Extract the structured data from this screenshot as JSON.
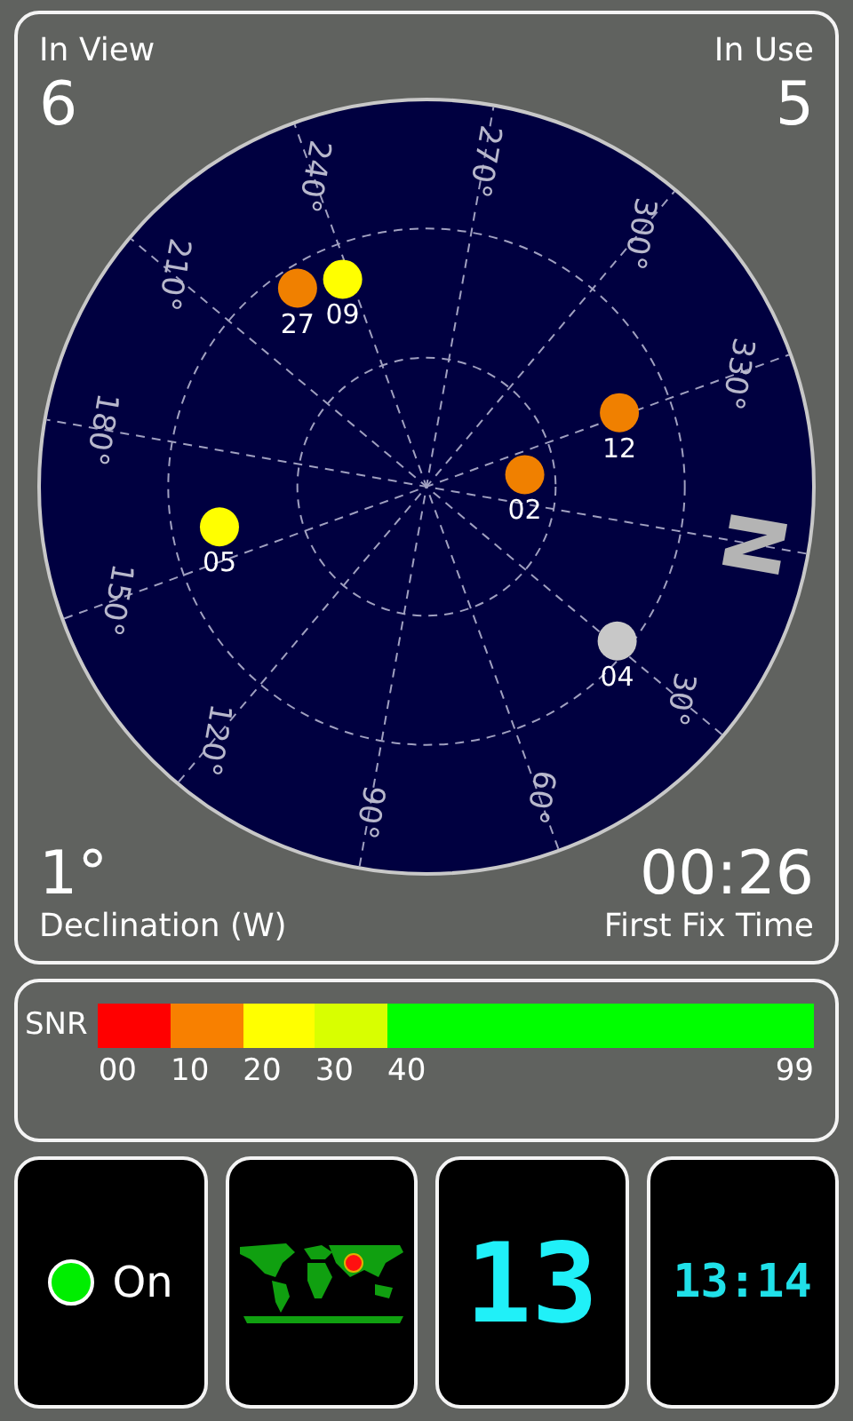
{
  "sky": {
    "in_view": {
      "label": "In View",
      "value": "6"
    },
    "in_use": {
      "label": "In Use",
      "value": "5"
    },
    "declination": {
      "label": "Declination (W)",
      "value": "1°"
    },
    "first_fix": {
      "label": "First Fix Time",
      "value": "00:26"
    },
    "north_label": "N",
    "azimuth_labels": [
      "30°",
      "60°",
      "90°",
      "120°",
      "150°",
      "180°",
      "210°",
      "240°",
      "270°",
      "300°",
      "330°"
    ],
    "satellites": [
      {
        "prn": "27",
        "color": "#f08000"
      },
      {
        "prn": "09",
        "color": "#ffff00"
      },
      {
        "prn": "12",
        "color": "#f08000"
      },
      {
        "prn": "02",
        "color": "#f08000"
      },
      {
        "prn": "05",
        "color": "#ffff00"
      },
      {
        "prn": "04",
        "color": "#c8c8c8"
      }
    ]
  },
  "snr": {
    "label": "SNR",
    "segments": [
      {
        "label": "00",
        "color": "#ff0000"
      },
      {
        "label": "10",
        "color": "#f88000"
      },
      {
        "label": "20",
        "color": "#ffff00"
      },
      {
        "label": "30",
        "color": "#d8ff00"
      },
      {
        "label": "40",
        "color": "#00ff00"
      }
    ],
    "max_label": "99"
  },
  "status": {
    "label": "On",
    "on": true
  },
  "satellite_count": "13",
  "clock": "13:14"
}
